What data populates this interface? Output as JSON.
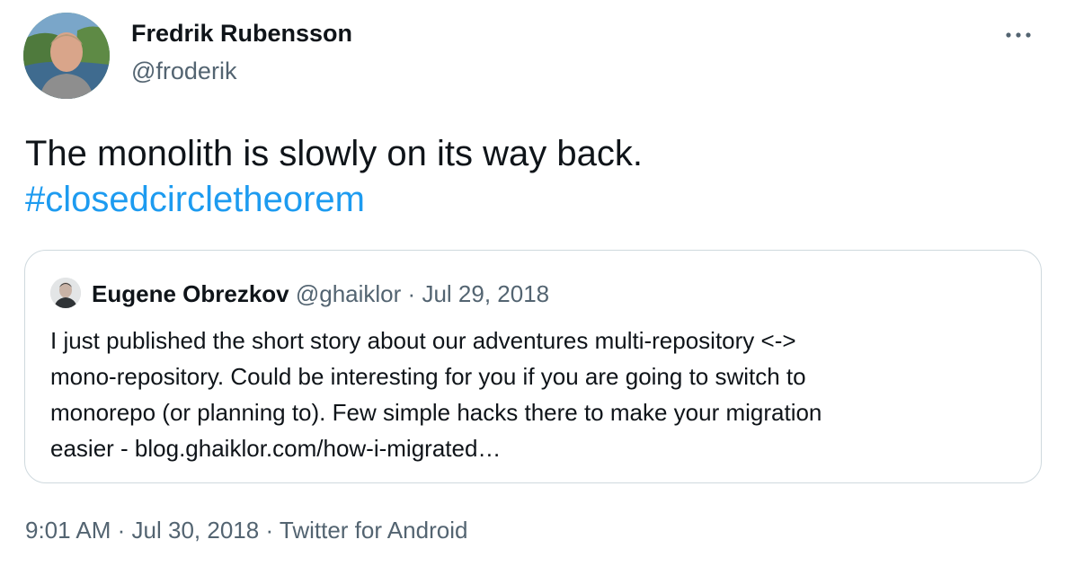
{
  "author": {
    "name": "Fredrik Rubensson",
    "handle": "@froderik"
  },
  "more_icon": "more-horizontal-icon",
  "tweet": {
    "text": "The monolith is slowly on its way back.",
    "hashtag": "#closedcircletheorem"
  },
  "quoted_tweet": {
    "author_name": "Eugene Obrezkov",
    "author_handle": "@ghaiklor",
    "separator": "·",
    "date": "Jul 29, 2018",
    "body_lines": [
      "I just published the short story about our adventures multi-repository <->",
      "mono-repository. Could be interesting for you if you are going to switch to",
      "monorepo (or planning to). Few simple hacks there to make your migration",
      "easier - blog.ghaiklor.com/how-i-migrated…"
    ]
  },
  "footer": {
    "time": "9:01 AM",
    "separator": "·",
    "date": "Jul 30, 2018",
    "source": "Twitter for Android"
  },
  "colors": {
    "text": "#0f1419",
    "secondary": "#536471",
    "link": "#1d9bf0",
    "border": "#cfd9de"
  }
}
